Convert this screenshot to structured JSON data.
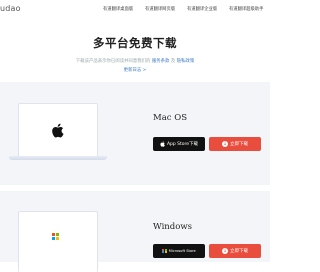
{
  "nav": {
    "logo": "udao",
    "items": [
      "有道翻译桌面版",
      "有道翻译网页版",
      "有道翻译企业版",
      "有道翻译超级助手"
    ]
  },
  "hero": {
    "title": "多平台免费下载",
    "subtitle": "下载该产品表示你已阅读并同意我们的",
    "service_link": "服务条款",
    "and": "及",
    "privacy_link": "隐私政策",
    "update_log": "更新日志 >"
  },
  "platforms": [
    {
      "name": "Mac OS",
      "store_button": "App Store下载",
      "store_icon": "apple-icon",
      "download_button": "立即下载"
    },
    {
      "name": "Windows",
      "store_button": "Microsoft Store",
      "store_icon": "windows-icon",
      "download_button": "立即下载"
    }
  ],
  "colors": {
    "accent": "#e84d3d",
    "dark_button": "#111111",
    "band_bg": "#f4f5f8",
    "link": "#3a78c9"
  }
}
